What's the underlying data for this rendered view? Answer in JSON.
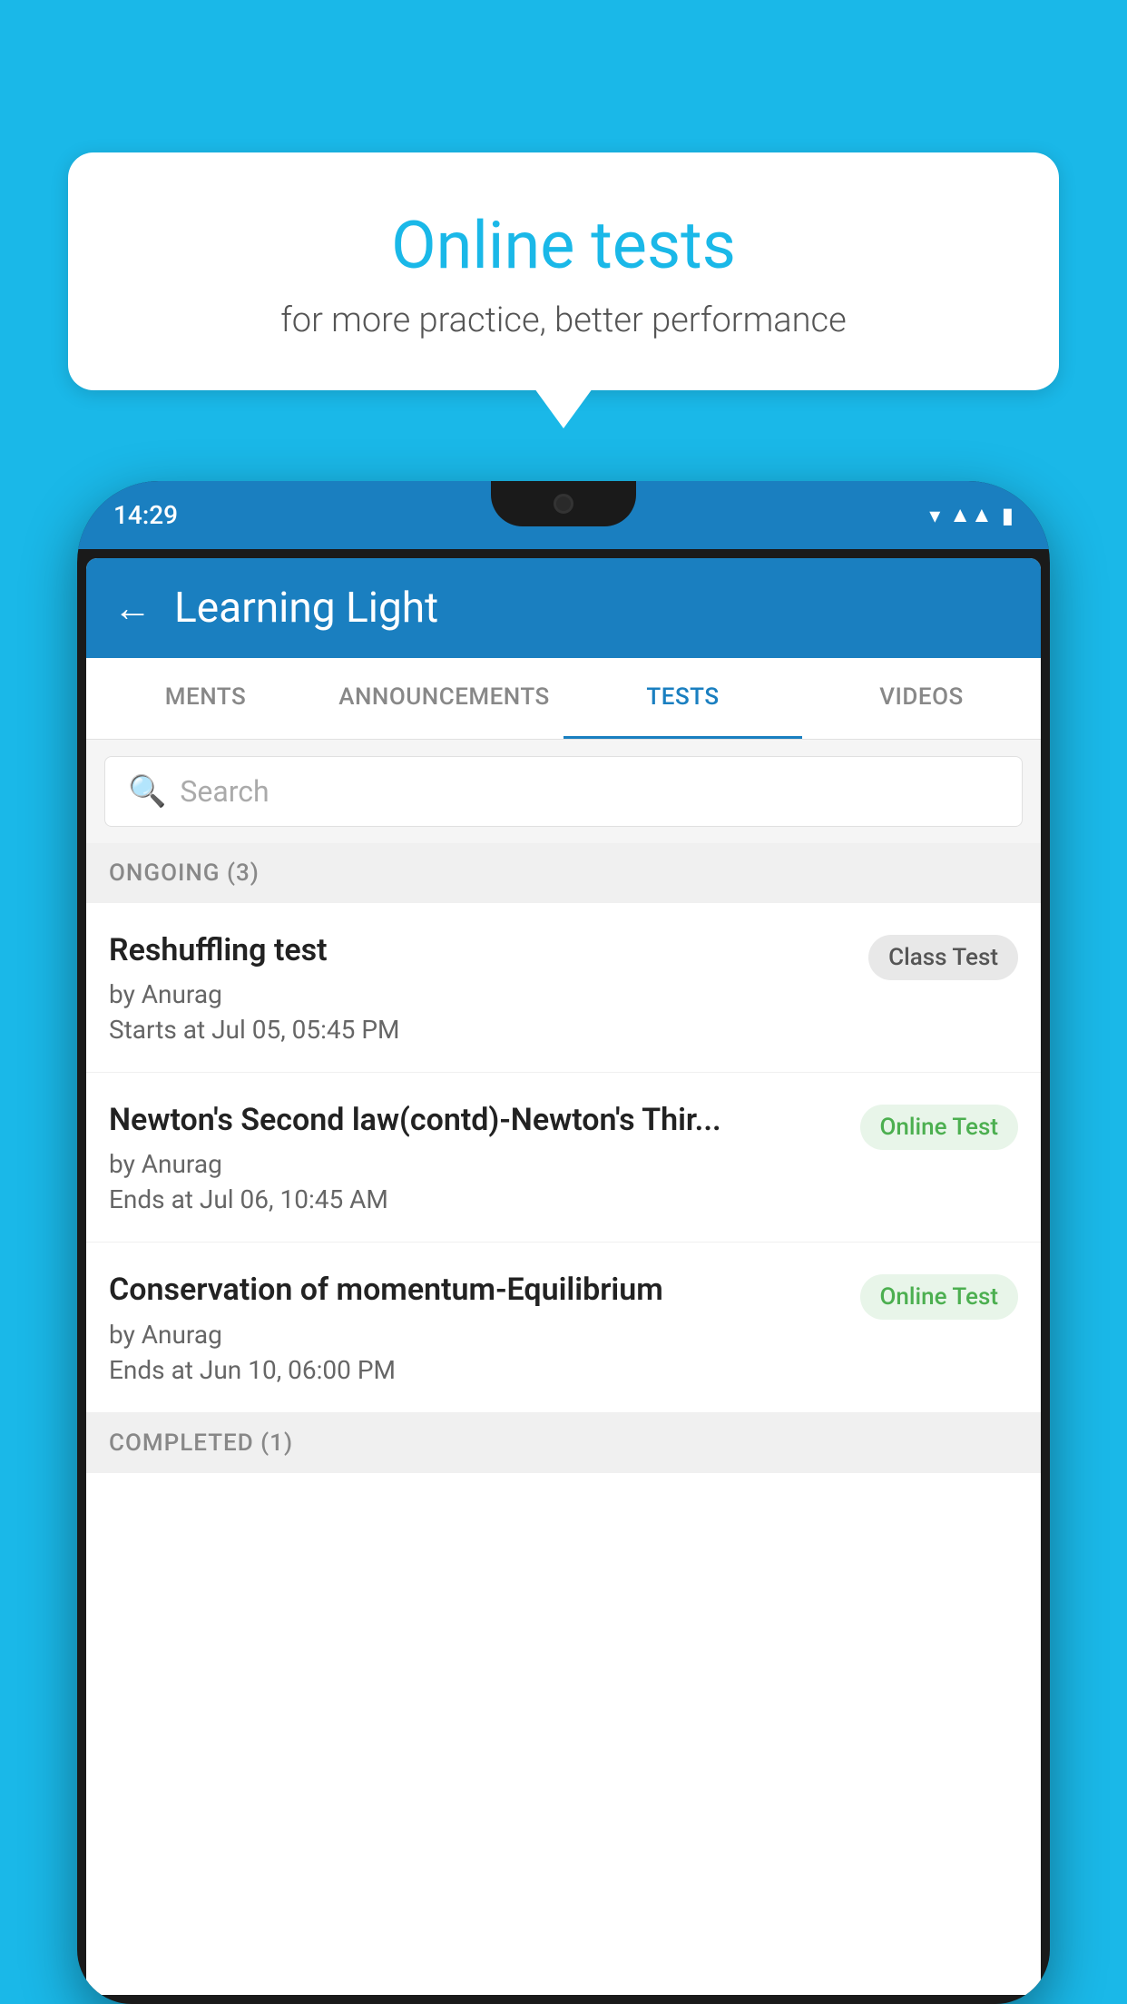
{
  "background_color": "#1ab8e8",
  "bubble": {
    "title": "Online tests",
    "subtitle": "for more practice, better performance"
  },
  "phone": {
    "status_bar": {
      "time": "14:29",
      "icons": [
        "wifi",
        "signal",
        "battery"
      ]
    },
    "app_bar": {
      "title": "Learning Light",
      "back_label": "←"
    },
    "tabs": [
      {
        "label": "MENTS",
        "active": false
      },
      {
        "label": "ANNOUNCEMENTS",
        "active": false
      },
      {
        "label": "TESTS",
        "active": true
      },
      {
        "label": "VIDEOS",
        "active": false
      }
    ],
    "search": {
      "placeholder": "Search"
    },
    "sections": [
      {
        "header": "ONGOING (3)",
        "items": [
          {
            "title": "Reshuffling test",
            "author": "by Anurag",
            "time_label": "Starts at",
            "time": "Jul 05, 05:45 PM",
            "badge": "Class Test",
            "badge_type": "class"
          },
          {
            "title": "Newton's Second law(contd)-Newton's Thir...",
            "author": "by Anurag",
            "time_label": "Ends at",
            "time": "Jul 06, 10:45 AM",
            "badge": "Online Test",
            "badge_type": "online"
          },
          {
            "title": "Conservation of momentum-Equilibrium",
            "author": "by Anurag",
            "time_label": "Ends at",
            "time": "Jun 10, 06:00 PM",
            "badge": "Online Test",
            "badge_type": "online"
          }
        ]
      },
      {
        "header": "COMPLETED (1)",
        "items": []
      }
    ]
  }
}
